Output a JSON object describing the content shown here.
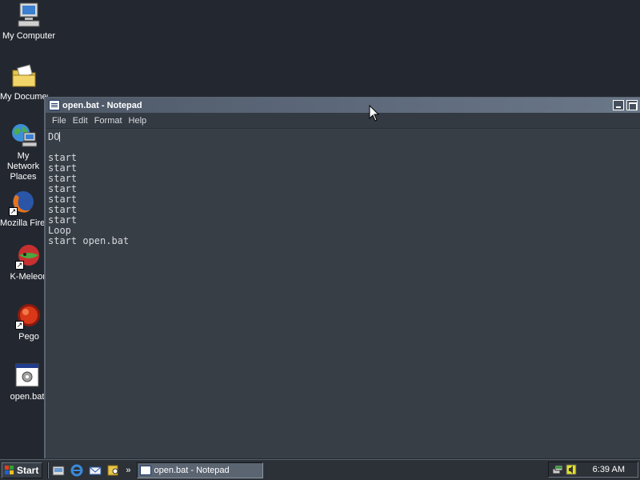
{
  "desktop": {
    "icons": [
      {
        "label": "My Computer"
      },
      {
        "label": "My Documents"
      },
      {
        "label": "My Network Places"
      },
      {
        "label": "Mozilla Firefox"
      },
      {
        "label": "K-Meleon"
      },
      {
        "label": "Pego"
      },
      {
        "label": "open.bat"
      }
    ]
  },
  "window": {
    "title": "open.bat - Notepad",
    "menu": [
      "File",
      "Edit",
      "Format",
      "Help"
    ],
    "content_lines": [
      "DO",
      "",
      "start",
      "start",
      "start",
      "start",
      "start",
      "start",
      "start",
      "Loop",
      "start open.bat"
    ]
  },
  "taskbar": {
    "start_label": "Start",
    "chevron": "»",
    "task_button_label": "open.bat - Notepad",
    "clock": "6:39 AM"
  },
  "icons": {
    "my_computer": "computer-icon",
    "my_documents": "folder-icon",
    "network": "network-icon",
    "firefox": "firefox-icon",
    "kmeleon": "kmeleon-icon",
    "pego": "pego-icon",
    "bat": "batch-file-icon"
  }
}
